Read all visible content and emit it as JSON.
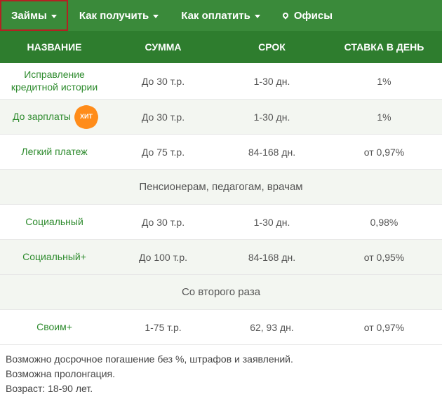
{
  "nav": {
    "items": [
      {
        "label": "Займы",
        "hasChevron": true,
        "hasPin": false,
        "highlighted": true
      },
      {
        "label": "Как получить",
        "hasChevron": true,
        "hasPin": false,
        "highlighted": false
      },
      {
        "label": "Как оплатить",
        "hasChevron": true,
        "hasPin": false,
        "highlighted": false
      },
      {
        "label": "Офисы",
        "hasChevron": false,
        "hasPin": true,
        "highlighted": false
      }
    ]
  },
  "table": {
    "headers": {
      "name": "НАЗВАНИЕ",
      "sum": "СУММА",
      "term": "СРОК",
      "rate": "СТАВКА В ДЕНЬ"
    },
    "rows": [
      {
        "name": "Исправление кредитной истории",
        "sum": "До 30 т.р.",
        "term": "1-30 дн.",
        "rate": "1%",
        "badge": ""
      },
      {
        "name": "До зарплаты",
        "sum": "До 30 т.р.",
        "term": "1-30 дн.",
        "rate": "1%",
        "badge": "ХИТ"
      },
      {
        "name": "Легкий платеж",
        "sum": "До 75 т.р.",
        "term": "84-168 дн.",
        "rate": "от 0,97%",
        "badge": ""
      }
    ],
    "section1": "Пенсионерам, педагогам, врачам",
    "rows2": [
      {
        "name": "Социальный",
        "sum": "До 30 т.р.",
        "term": "1-30 дн.",
        "rate": "0,98%"
      },
      {
        "name": "Социальный+",
        "sum": "До 100 т.р.",
        "term": "84-168 дн.",
        "rate": "от 0,95%"
      }
    ],
    "section2": "Со второго раза",
    "rows3": [
      {
        "name": "Своим+",
        "sum": "1-75 т.р.",
        "term": "62, 93 дн.",
        "rate": "от 0,97%"
      }
    ]
  },
  "footer": {
    "line1": "Возможно досрочное погашение без %, штрафов и заявлений.",
    "line2": "Возможна пролонгация.",
    "line3": "Возраст: 18-90 лет."
  }
}
